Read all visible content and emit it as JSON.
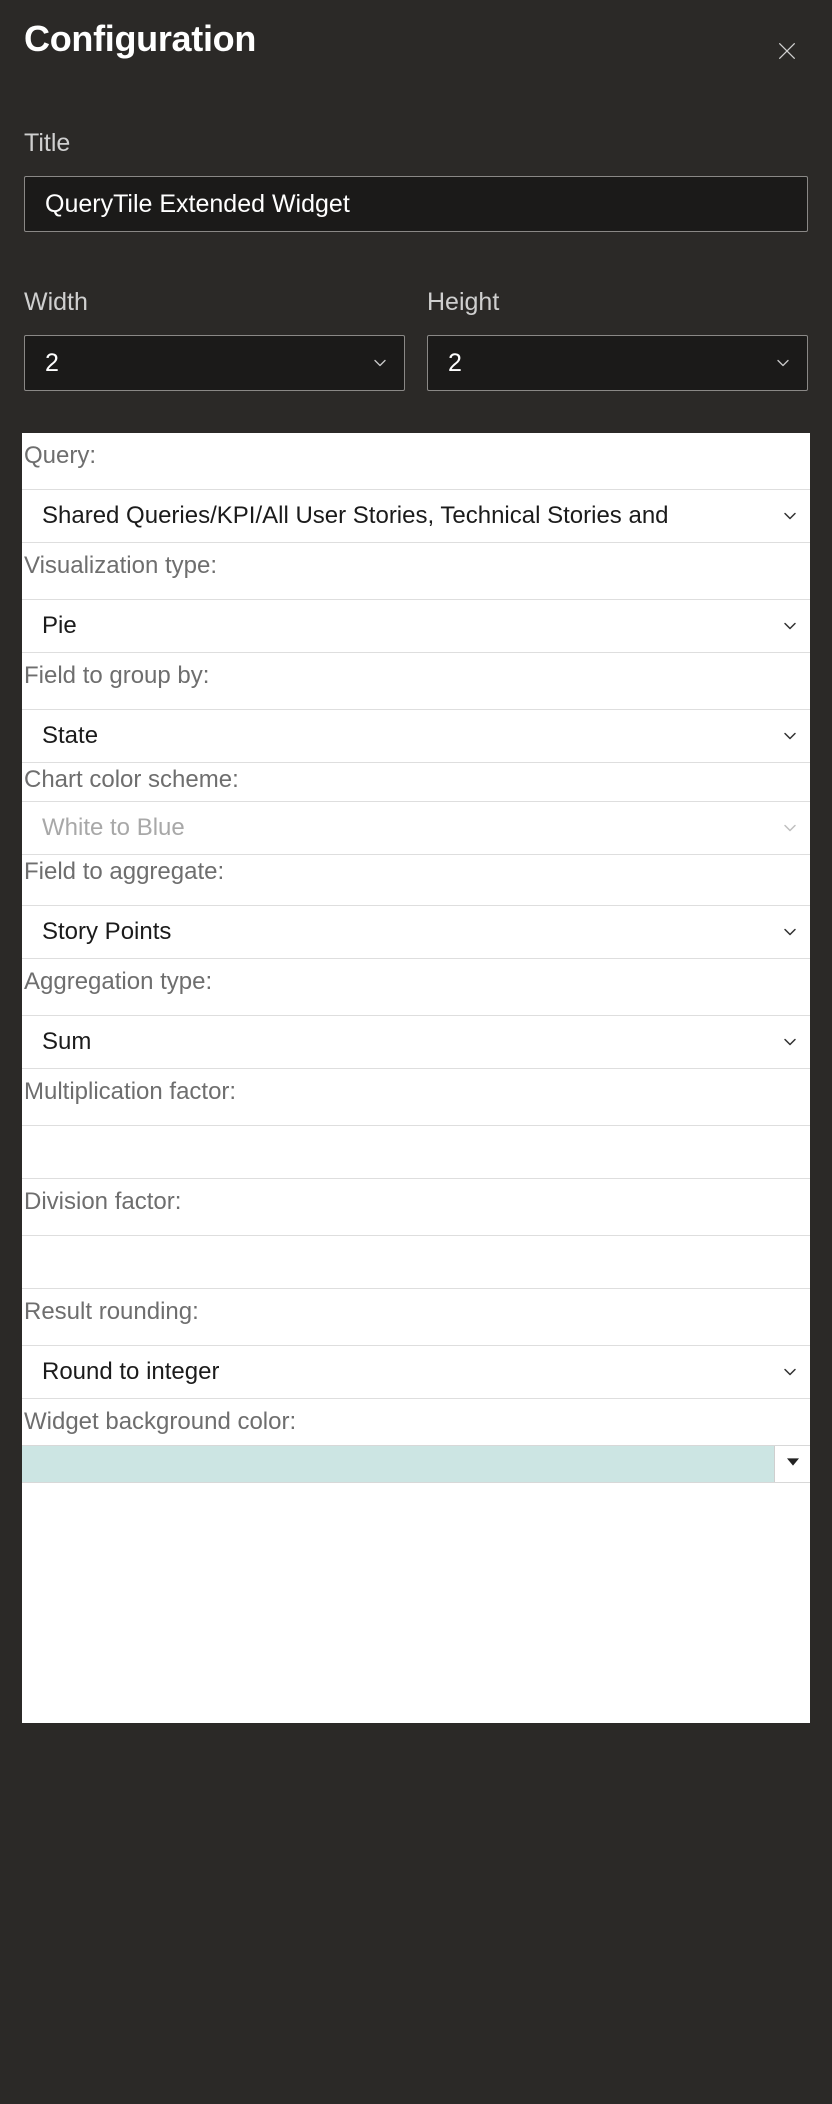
{
  "header": {
    "title": "Configuration"
  },
  "fields": {
    "title_label": "Title",
    "title_value": "QueryTile Extended Widget",
    "width_label": "Width",
    "width_value": "2",
    "height_label": "Height",
    "height_value": "2"
  },
  "light": {
    "query_label": "Query:",
    "query_value": "Shared Queries/KPI/All User Stories, Technical Stories and",
    "viz_label": "Visualization type:",
    "viz_value": "Pie",
    "group_label": "Field to group by:",
    "group_value": "State",
    "scheme_label": "Chart color scheme:",
    "scheme_value": "White to Blue",
    "agg_field_label": "Field to aggregate:",
    "agg_field_value": "Story Points",
    "agg_type_label": "Aggregation type:",
    "agg_type_value": "Sum",
    "mult_label": "Multiplication factor:",
    "mult_value": "",
    "div_label": "Division factor:",
    "div_value": "",
    "round_label": "Result rounding:",
    "round_value": "Round to integer",
    "bg_label": "Widget background color:",
    "bg_value": "#cce5e3"
  }
}
